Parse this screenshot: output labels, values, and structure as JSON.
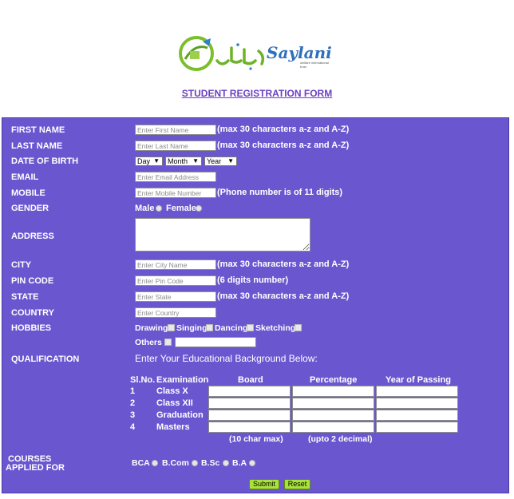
{
  "logo": {
    "text": "Saylani",
    "tagline": "welfare international trust"
  },
  "form_title": "STUDENT REGISTRATION FORM",
  "colors": {
    "panel": "#6a57cf",
    "title": "#6a3fc3",
    "button": "#a8e23a"
  },
  "fields": {
    "first_name": {
      "label": "FIRST NAME",
      "placeholder": "Enter First Name",
      "note": "(max 30 characters a-z and A-Z)"
    },
    "last_name": {
      "label": "LAST NAME",
      "placeholder": "Enter Last Name",
      "note": "(max 30 characters a-z and A-Z)"
    },
    "dob": {
      "label": "DATE OF BIRTH",
      "day": "Day",
      "month": "Month",
      "year": "Year"
    },
    "email": {
      "label": "EMAIL",
      "placeholder": "Enter Email Address"
    },
    "mobile": {
      "label": "MOBILE",
      "placeholder": "Enter Mobile Number",
      "note": "(Phone number is of 11 digits)"
    },
    "gender": {
      "label": "GENDER",
      "male": "Male",
      "female": "Female"
    },
    "address": {
      "label": "ADDRESS"
    },
    "city": {
      "label": "CITY",
      "placeholder": "Enter City Name",
      "note": "(max 30 characters a-z and A-Z)"
    },
    "pin": {
      "label": "PIN CODE",
      "placeholder": "Enter Pin Code",
      "note": "(6 digits number)"
    },
    "state": {
      "label": "STATE",
      "placeholder": "Enter State",
      "note": "(max 30 characters a-z and A-Z)"
    },
    "country": {
      "label": "COUNTRY",
      "placeholder": "Enter Country"
    },
    "hobbies": {
      "label": "HOBBIES",
      "items": [
        "Drawing",
        "Singing",
        "Dancing",
        "Sketching"
      ],
      "others": "Others"
    },
    "qualification": {
      "label": "QUALIFICATION",
      "intro": "Enter Your Educational Background Below:",
      "headers": [
        "Sl.No.",
        "Examination",
        "Board",
        "Percentage",
        "Year of Passing"
      ],
      "rows": [
        {
          "no": "1",
          "exam": "Class X"
        },
        {
          "no": "2",
          "exam": "Class XII"
        },
        {
          "no": "3",
          "exam": "Graduation"
        },
        {
          "no": "4",
          "exam": "Masters"
        }
      ],
      "board_note": "(10 char max)",
      "percent_note": "(upto 2 decimal)"
    },
    "courses": {
      "label_line1": "COURSES",
      "label_line2": "APPLIED FOR",
      "options": [
        "BCA",
        "B.Com",
        "B.Sc",
        "B.A"
      ]
    }
  },
  "buttons": {
    "submit": "Submit",
    "reset": "Reset"
  }
}
